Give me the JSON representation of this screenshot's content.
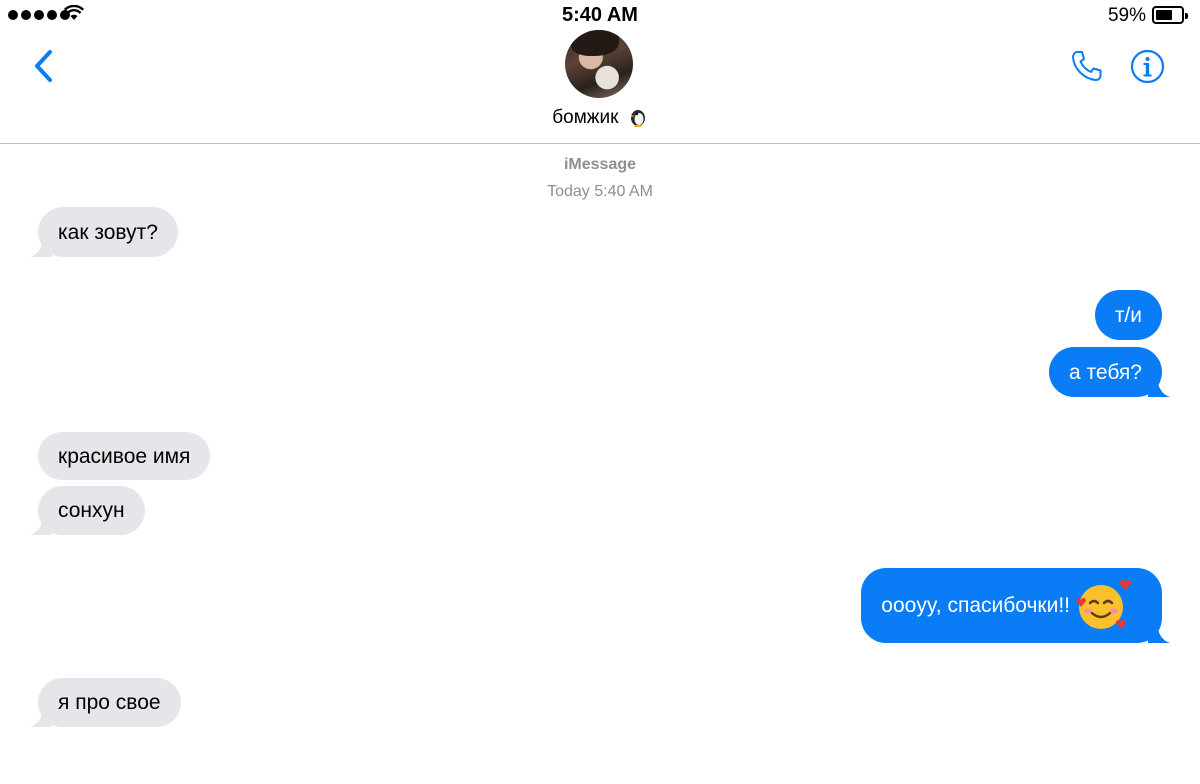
{
  "status_bar": {
    "time": "5:40 AM",
    "battery_percent": "59%",
    "signal_bars": 5,
    "battery_level": 0.59
  },
  "header": {
    "contact_name": "бомжик",
    "contact_emoji_icon": "penguin-icon",
    "back_icon": "chevron-left-icon",
    "call_icon": "phone-icon",
    "info_icon": "info-icon",
    "accent_color": "#0a7cf5"
  },
  "thread": {
    "service_label": "iMessage",
    "timestamp": "Today 5:40 AM",
    "messages": [
      {
        "direction": "incoming",
        "text": "как зовут?"
      },
      {
        "direction": "outgoing",
        "text": "т/и"
      },
      {
        "direction": "outgoing",
        "text": "а тебя?"
      },
      {
        "direction": "incoming",
        "text": "красивое имя"
      },
      {
        "direction": "incoming",
        "text": "сонхун"
      },
      {
        "direction": "outgoing",
        "text": "oooyy, спасибочки!!",
        "emoji": "smiling-face-with-hearts-icon"
      },
      {
        "direction": "incoming",
        "text": "я про свое"
      }
    ],
    "incoming_color": "#e5e5ea",
    "outgoing_color": "#0a7cf5"
  }
}
